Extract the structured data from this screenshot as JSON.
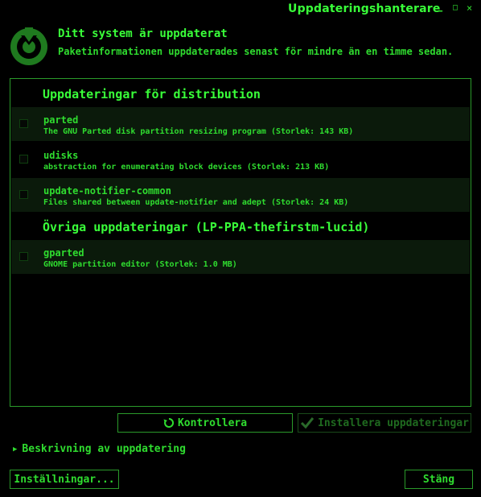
{
  "window": {
    "title": "Uppdateringshanterare",
    "min_glyph": "▁",
    "max_glyph": "□",
    "close_glyph": "×"
  },
  "header": {
    "title": "Ditt system är uppdaterat",
    "subtitle": "Paketinformationen uppdaterades senast för mindre än en timme sedan.",
    "icon": "update-manager-logo-icon"
  },
  "updates": {
    "sections": [
      {
        "title": "Uppdateringar för distribution",
        "packages": [
          {
            "name": "parted",
            "description": "The GNU Parted disk partition resizing program (Storlek: 143 KB)"
          },
          {
            "name": "udisks",
            "description": "abstraction for enumerating block devices (Storlek: 213 KB)"
          },
          {
            "name": "update-notifier-common",
            "description": "Files shared between update-notifier and adept (Storlek: 24 KB)"
          }
        ]
      },
      {
        "title": "Övriga uppdateringar (LP-PPA-thefirstm-lucid)",
        "packages": [
          {
            "name": "gparted",
            "description": "GNOME partition editor (Storlek: 1.0 MB)"
          }
        ]
      }
    ]
  },
  "buttons": {
    "check": "Kontrollera",
    "install": "Installera uppdateringar",
    "settings": "Inställningar...",
    "close": "Stäng"
  },
  "expander": {
    "label": "Beskrivning av uppdatering"
  },
  "colors": {
    "foreground": "#2fdc2f",
    "bright": "#39ff39",
    "border": "#2a9a2a",
    "background": "#000000",
    "row_alt": "#0b1a0b"
  }
}
